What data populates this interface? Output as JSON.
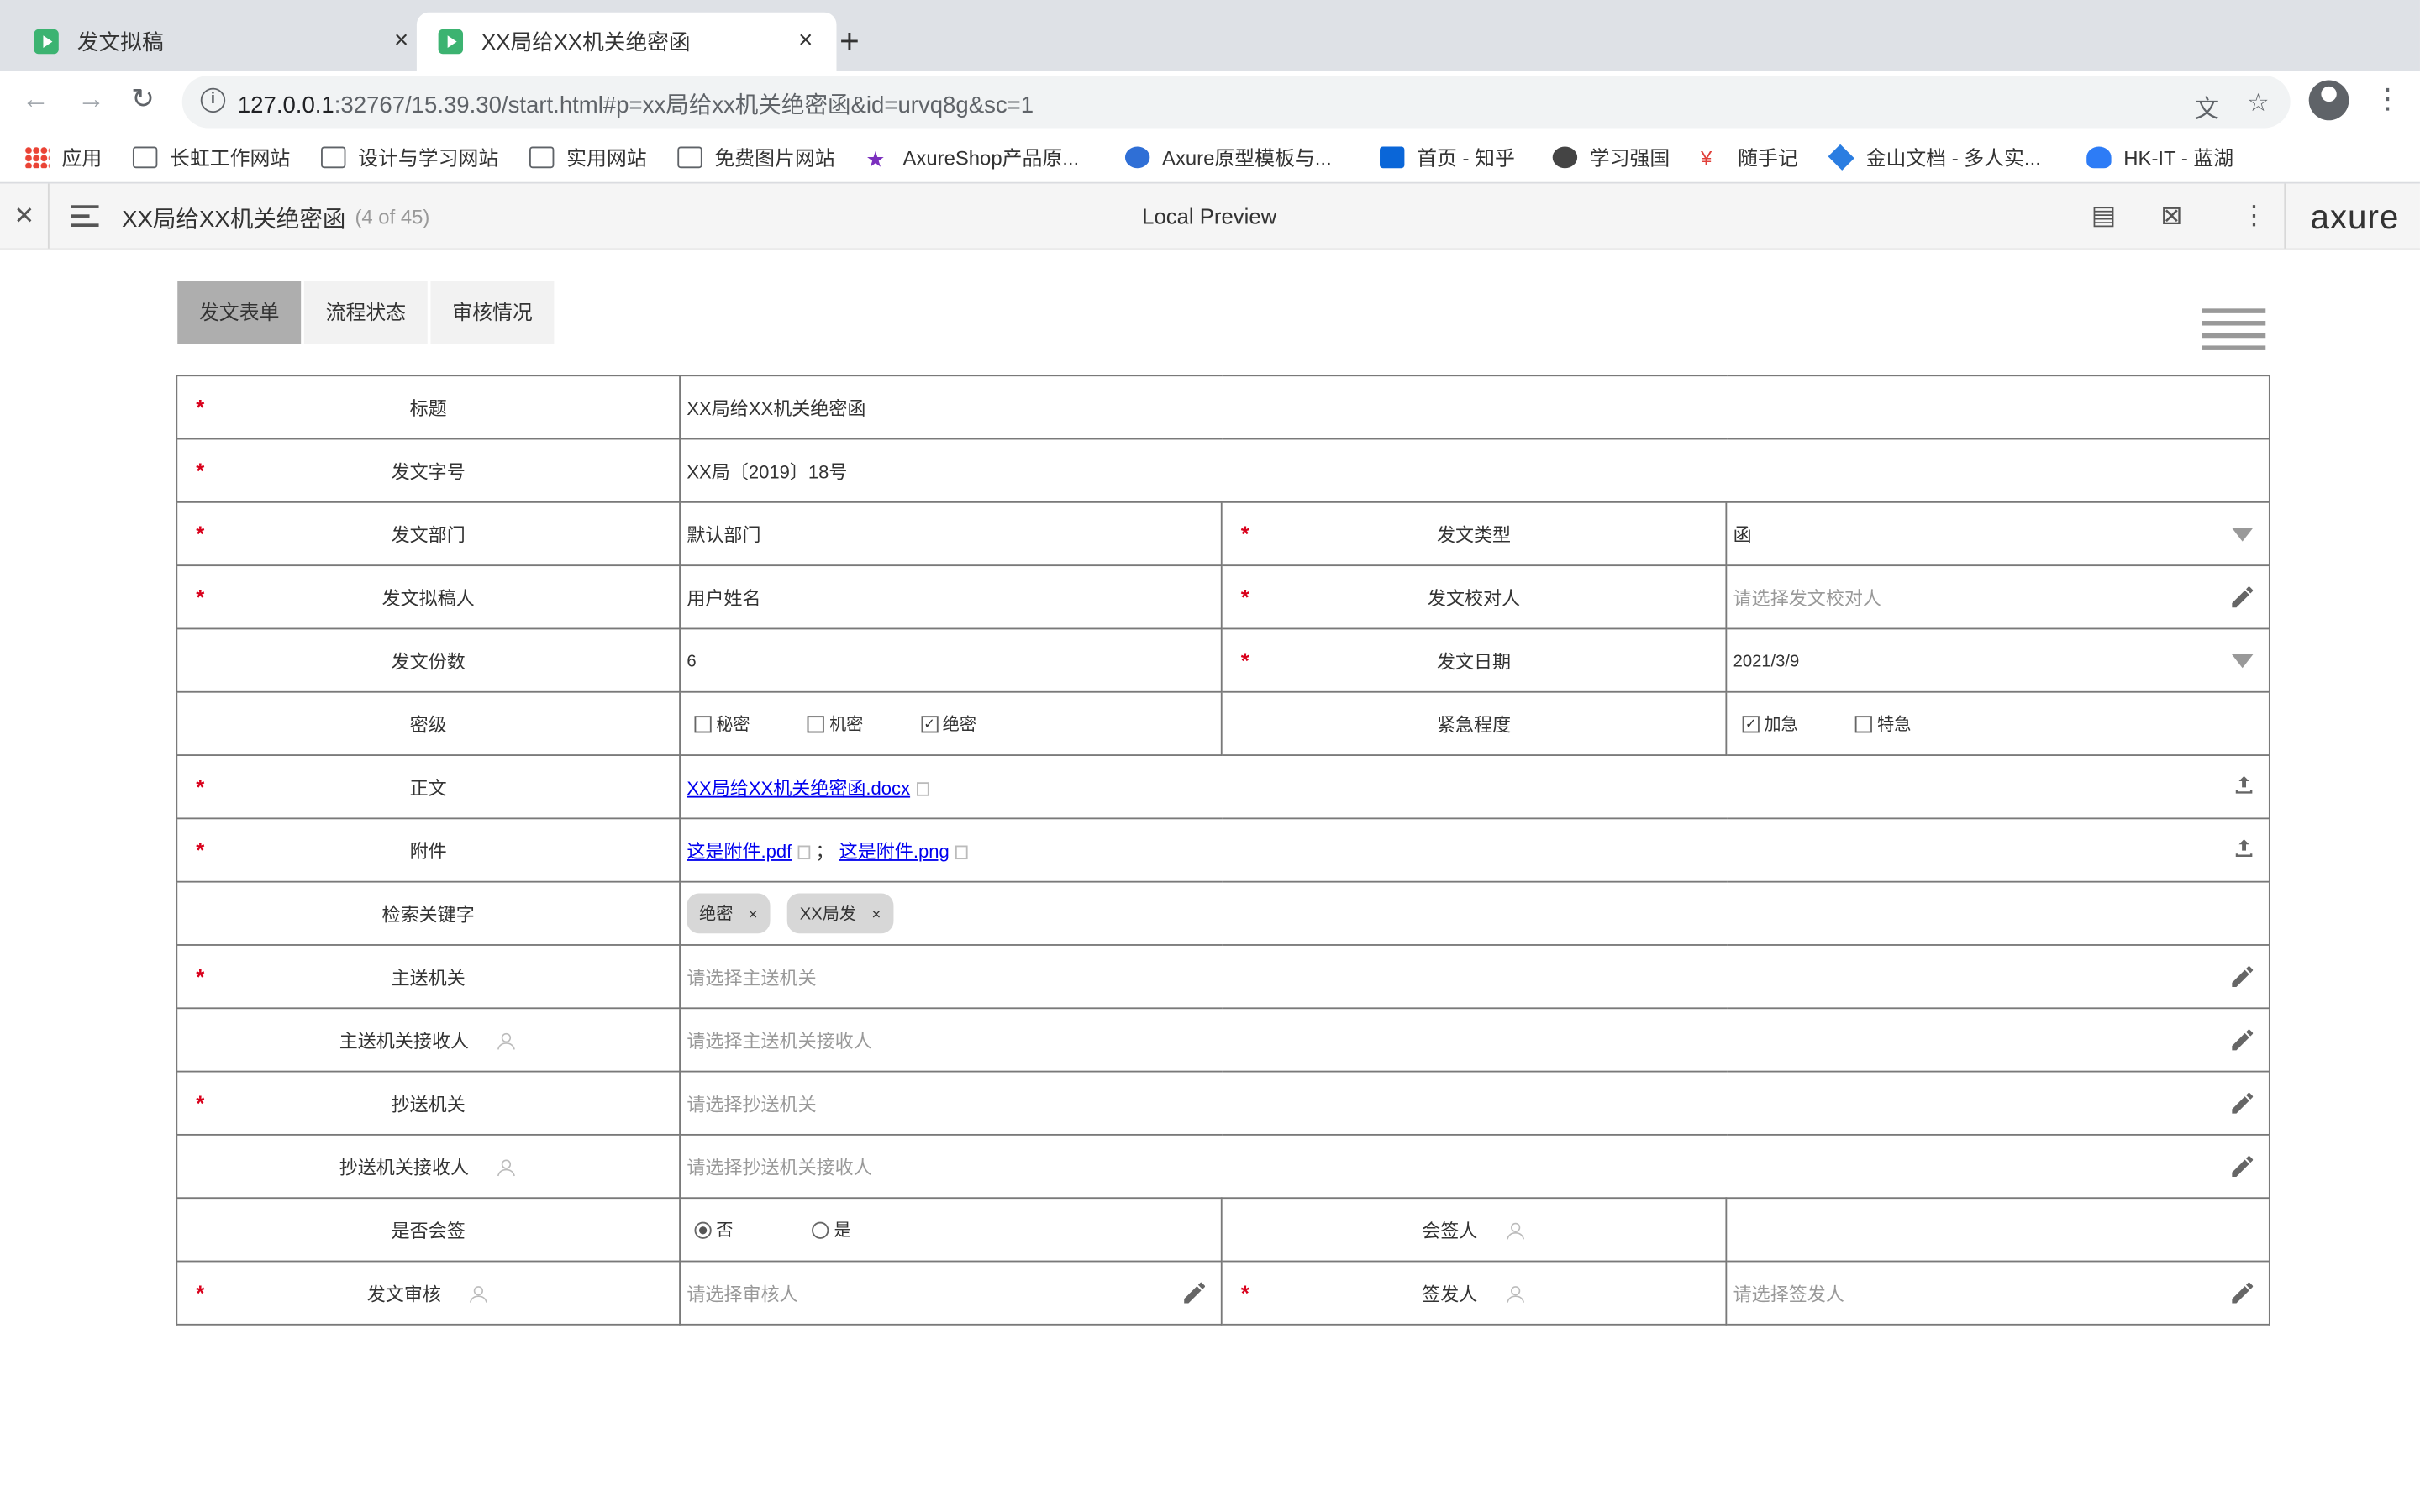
{
  "browser": {
    "tabs": [
      {
        "title": "发文拟稿",
        "close": "×"
      },
      {
        "title": "XX局给XX机关绝密函",
        "close": "×"
      }
    ],
    "new_tab": "+",
    "url_host": "127.0.0.1",
    "url_rest": ":32767/15.39.30/start.html#p=xx局给xx机关绝密函&id=urvq8g&sc=1",
    "bookmarks": [
      "应用",
      "长虹工作网站",
      "设计与学习网站",
      "实用网站",
      "免费图片网站",
      "AxureShop产品原...",
      "Axure原型模板与...",
      "首页 - 知乎",
      "学习强国",
      "随手记",
      "金山文档 - 多人实...",
      "HK-IT - 蓝湖"
    ]
  },
  "axure": {
    "page_title": "XX局给XX机关绝密函",
    "page_count": "(4 of 45)",
    "preview_label": "Local Preview",
    "logo": "axure"
  },
  "content_tabs": [
    "发文表单",
    "流程状态",
    "审核情况"
  ],
  "form": {
    "title_label": "标题",
    "title_value": "XX局给XX机关绝密函",
    "docno_label": "发文字号",
    "docno_value": "XX局〔2019〕18号",
    "dept_label": "发文部门",
    "dept_value": "默认部门",
    "type_label": "发文类型",
    "type_value": "函",
    "drafter_label": "发文拟稿人",
    "drafter_value": "用户姓名",
    "proofer_label": "发文校对人",
    "proofer_placeholder": "请选择发文校对人",
    "copies_label": "发文份数",
    "copies_value": "6",
    "date_label": "发文日期",
    "date_value": "2021/3/9",
    "secret_label": "密级",
    "secret_options": [
      "秘密",
      "机密",
      "绝密"
    ],
    "urgency_label": "紧急程度",
    "urgency_options": [
      "加急",
      "特急"
    ],
    "body_label": "正文",
    "body_file": "XX局给XX机关绝密函.docx",
    "attach_label": "附件",
    "attach_files": [
      "这是附件.pdf",
      "这是附件.png"
    ],
    "attach_sep": "；",
    "keywords_label": "检索关键字",
    "keywords": [
      "绝密",
      "XX局发"
    ],
    "chip_close": "×",
    "main_org_label": "主送机关",
    "main_org_placeholder": "请选择主送机关",
    "main_recv_label": "主送机关接收人",
    "main_recv_placeholder": "请选择主送机关接收人",
    "cc_org_label": "抄送机关",
    "cc_org_placeholder": "请选择抄送机关",
    "cc_recv_label": "抄送机关接收人",
    "cc_recv_placeholder": "请选择抄送机关接收人",
    "cosign_label": "是否会签",
    "cosign_options": [
      "否",
      "是"
    ],
    "cosigner_label": "会签人",
    "review_label": "发文审核",
    "review_placeholder": "请选择审核人",
    "issuer_label": "签发人",
    "issuer_placeholder": "请选择签发人",
    "required_mark": "*",
    "checked_mark": "✓"
  }
}
